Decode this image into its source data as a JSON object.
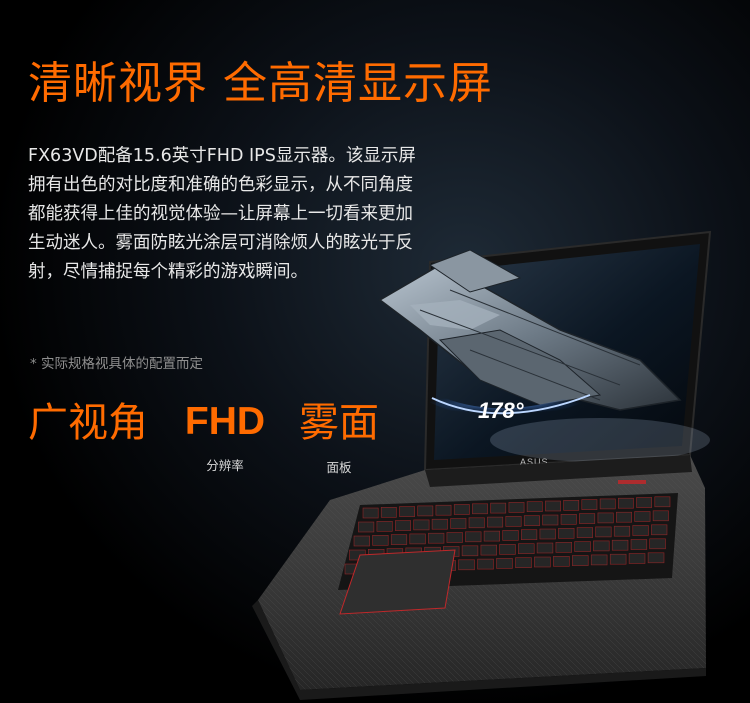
{
  "headline": "清晰视界 全高清显示屏",
  "description": "FX63VD配备15.6英寸FHD IPS显示器。该显示屏拥有出色的对比度和准确的色彩显示，从不同角度都能获得上佳的视觉体验—让屏幕上一切看来更加生动迷人。雾面防眩光涂层可消除烦人的眩光于反射，尽情捕捉每个精彩的游戏瞬间。",
  "note": "* 实际规格视具体的配置而定",
  "features": [
    {
      "title": "广视角",
      "subtitle": ""
    },
    {
      "title": "FHD",
      "subtitle": "分辨率"
    },
    {
      "title": "雾面",
      "subtitle": "面板"
    }
  ],
  "laptop": {
    "angle_label": "178°",
    "brand_logo": "ASUS"
  },
  "colors": {
    "accent": "#ff6b00",
    "text": "#e8e8e8",
    "note": "#8f8f8f",
    "keyboard_backlight": "#c0282a"
  }
}
